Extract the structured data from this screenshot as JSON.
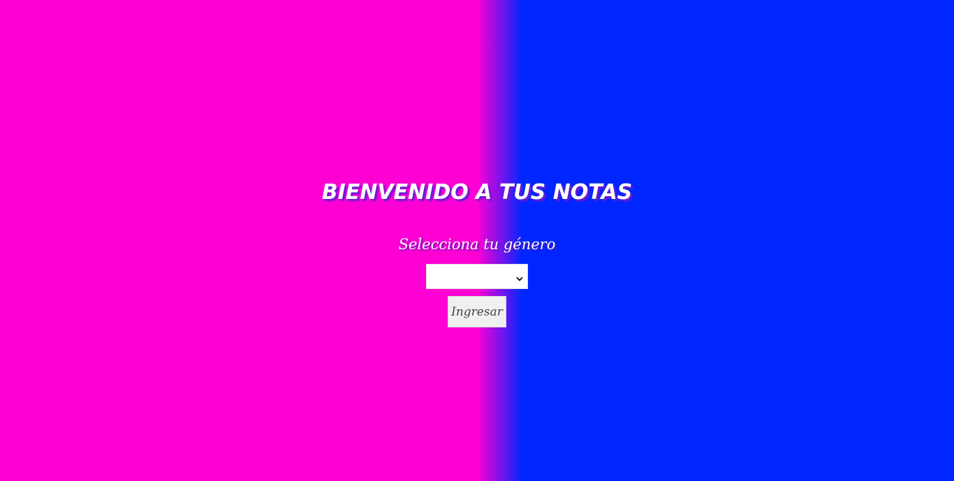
{
  "header": {
    "title": "BIENVENIDO A TUS NOTAS"
  },
  "form": {
    "gender_label": "Selecciona tu género",
    "gender_select": {
      "selected_value": "",
      "icon": "chevron-down-icon"
    },
    "submit_label": "Ingresar"
  },
  "colors": {
    "left_background": "#ff00d4",
    "right_background": "#0026ff",
    "text": "#ffffff",
    "text_shadow": "#6a1bd1",
    "button_background": "#f0f0f0"
  }
}
